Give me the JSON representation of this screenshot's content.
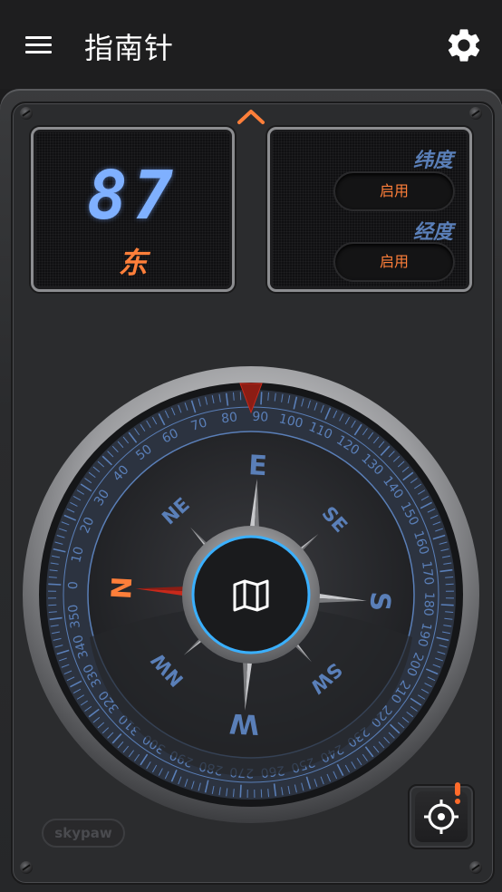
{
  "app_bar": {
    "title": "指南针",
    "menu_icon": "hamburger-menu-icon",
    "settings_icon": "gear-icon"
  },
  "heading": {
    "degrees": "87",
    "direction": "东"
  },
  "coordinates": {
    "latitude_label": "纬度",
    "latitude_button": "启用",
    "longitude_label": "经度",
    "longitude_button": "启用"
  },
  "compass": {
    "heading_deg": 87,
    "cardinals": {
      "E": "E",
      "S": "S",
      "W": "W",
      "N": "N"
    },
    "intercardinals": {
      "NE": "NE",
      "SE": "SE",
      "SW": "SW",
      "NW": "NW"
    },
    "center_icon": "map-icon",
    "dial_ticks": [
      "0",
      "10",
      "20",
      "30",
      "40",
      "50",
      "60",
      "70",
      "80",
      "90",
      "100",
      "110",
      "120",
      "130",
      "140",
      "150",
      "160",
      "170",
      "180",
      "190",
      "200",
      "210",
      "220",
      "230",
      "240",
      "250",
      "260",
      "270",
      "280",
      "290",
      "300",
      "310",
      "320",
      "330",
      "340",
      "350"
    ]
  },
  "footer": {
    "brand": "skypaw",
    "locate_icon": "crosshair-icon",
    "alert_icon": "exclamation-icon"
  },
  "colors": {
    "accent": "#ff7f3a",
    "digits": "#7fb0ff",
    "dial": "#5a7fb8",
    "needle": "#c8291b"
  }
}
